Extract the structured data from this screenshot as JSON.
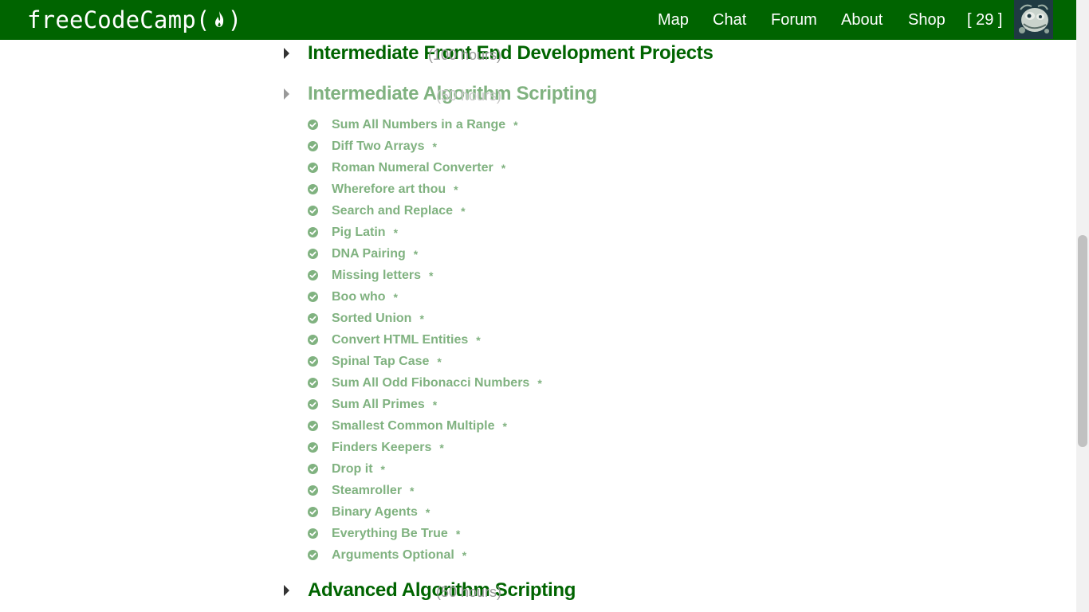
{
  "navbar": {
    "logo": {
      "text": "freeCodeCamp",
      "open_paren": "(",
      "close_paren": ")",
      "icon": "flame-icon"
    },
    "links": [
      {
        "label": "Map"
      },
      {
        "label": "Chat"
      },
      {
        "label": "Forum"
      },
      {
        "label": "About"
      },
      {
        "label": "Shop"
      }
    ],
    "points": "[ 29 ]",
    "avatar_icon": "user-avatar-icon"
  },
  "blocks": {
    "intermediate_front_end": {
      "title": "Intermediate Front End Development Projects",
      "hours": "(100 hours)"
    },
    "intermediate_algorithm": {
      "title": "Intermediate Algorithm Scripting",
      "hours": "(50 hours)",
      "challenges": [
        {
          "name": "Sum All Numbers in a Range",
          "marker": "*"
        },
        {
          "name": "Diff Two Arrays",
          "marker": "*"
        },
        {
          "name": "Roman Numeral Converter",
          "marker": "*"
        },
        {
          "name": "Wherefore art thou",
          "marker": "*"
        },
        {
          "name": "Search and Replace",
          "marker": "*"
        },
        {
          "name": "Pig Latin",
          "marker": "*"
        },
        {
          "name": "DNA Pairing",
          "marker": "*"
        },
        {
          "name": "Missing letters",
          "marker": "*"
        },
        {
          "name": "Boo who",
          "marker": "*"
        },
        {
          "name": "Sorted Union",
          "marker": "*"
        },
        {
          "name": "Convert HTML Entities",
          "marker": "*"
        },
        {
          "name": "Spinal Tap Case",
          "marker": "*"
        },
        {
          "name": "Sum All Odd Fibonacci Numbers",
          "marker": "*"
        },
        {
          "name": "Sum All Primes",
          "marker": "*"
        },
        {
          "name": "Smallest Common Multiple",
          "marker": "*"
        },
        {
          "name": "Finders Keepers",
          "marker": "*"
        },
        {
          "name": "Drop it",
          "marker": "*"
        },
        {
          "name": "Steamroller",
          "marker": "*"
        },
        {
          "name": "Binary Agents",
          "marker": "*"
        },
        {
          "name": "Everything Be True",
          "marker": "*"
        },
        {
          "name": "Arguments Optional",
          "marker": "*"
        }
      ]
    },
    "advanced_algorithm": {
      "title": "Advanced Algorithm Scripting",
      "hours": "(50 hours)"
    }
  },
  "colors": {
    "brand_green": "#006400",
    "completed_green": "#80b280",
    "hours_gray": "#999999"
  }
}
